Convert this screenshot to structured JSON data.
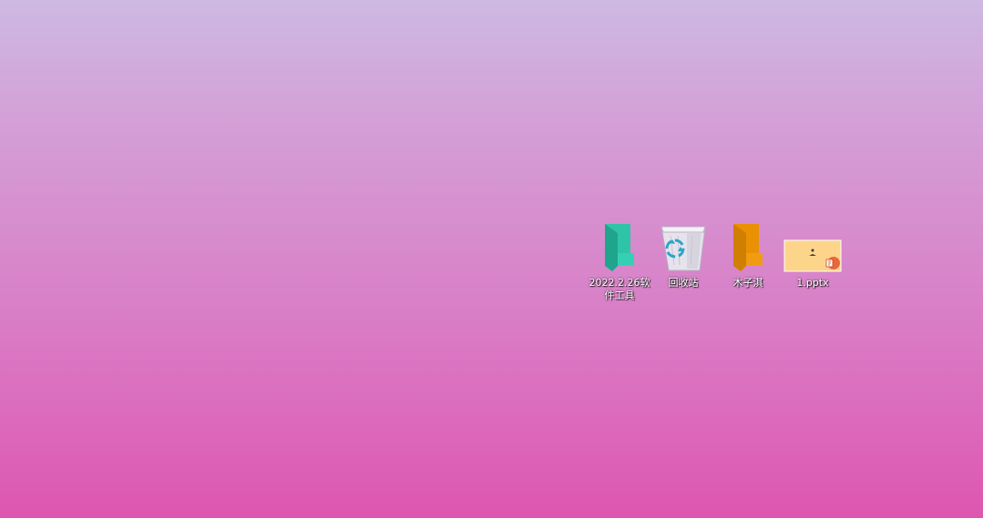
{
  "desktop": {
    "icons": [
      {
        "label": "2022.2.26软件工具",
        "icon": "folder-icon",
        "color": "#2fc4a8"
      },
      {
        "label": "回收站",
        "icon": "recycle-bin-icon"
      },
      {
        "label": "木子淇",
        "icon": "folder-icon",
        "color": "#ea9003"
      },
      {
        "label": "1.pptx",
        "icon": "pptx-file-icon"
      }
    ]
  }
}
